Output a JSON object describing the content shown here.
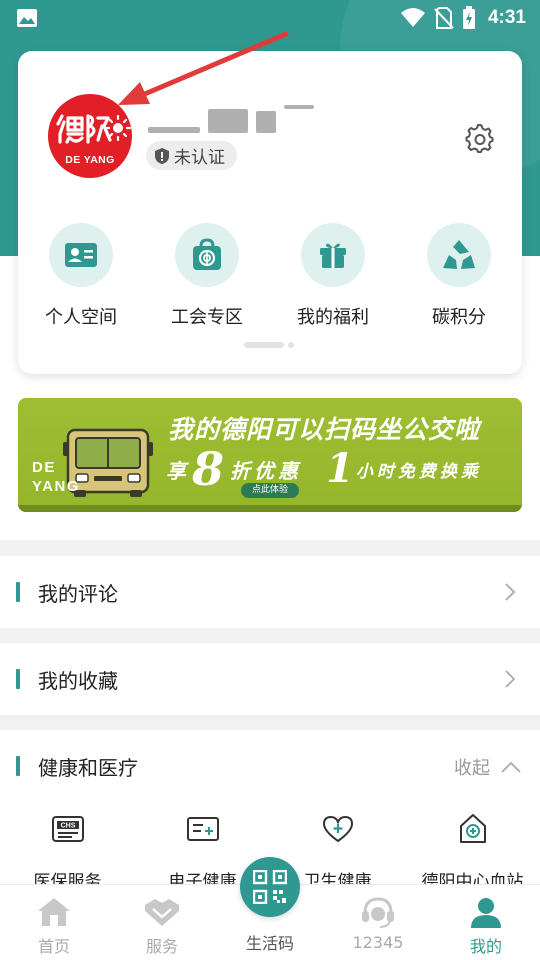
{
  "statusbar": {
    "time": "4:31",
    "icons": [
      "image-icon",
      "wifi-icon",
      "no-sim-icon",
      "battery-icon"
    ]
  },
  "profile": {
    "logo_text": "DE YANG",
    "username": "",
    "badge_label": "未认证",
    "settings_icon": "gear-icon"
  },
  "quick_actions": [
    {
      "label": "个人空间",
      "icon": "id-card-icon"
    },
    {
      "label": "工会专区",
      "icon": "union-bag-icon"
    },
    {
      "label": "我的福利",
      "icon": "gift-icon"
    },
    {
      "label": "碳积分",
      "icon": "recycle-icon"
    }
  ],
  "banner": {
    "title": "我的德阳可以扫码坐公交啦",
    "prefix": "享",
    "discount": "8",
    "discount_suffix": "折优惠",
    "hours": "1",
    "hours_suffix": "小时免费换乘",
    "cta": "点此体验",
    "brand_line1": "DE",
    "brand_line2": "YANG"
  },
  "sections": {
    "comments": "我的评论",
    "favorites": "我的收藏",
    "health": "健康和医疗",
    "health_collapse": "收起"
  },
  "health_items": [
    {
      "label": "医保服务",
      "icon": "chs-icon",
      "icon_text": "CHS"
    },
    {
      "label": "电子健康",
      "icon": "health-card-icon"
    },
    {
      "label": "卫生健康",
      "icon": "heart-plus-icon"
    },
    {
      "label": "德阳中心血站",
      "icon": "blood-station-icon"
    }
  ],
  "tabs": [
    {
      "label": "首页",
      "icon": "home-icon"
    },
    {
      "label": "服务",
      "icon": "handshake-icon"
    },
    {
      "label": "生活码",
      "icon": "qr-code-icon"
    },
    {
      "label": "12345",
      "icon": "headset-icon"
    },
    {
      "label": "我的",
      "icon": "person-icon"
    }
  ],
  "colors": {
    "brand": "#2f9991",
    "logo_red": "#e21f26",
    "banner_green": "#9fbe33",
    "annotation_arrow": "#e03a3a"
  }
}
